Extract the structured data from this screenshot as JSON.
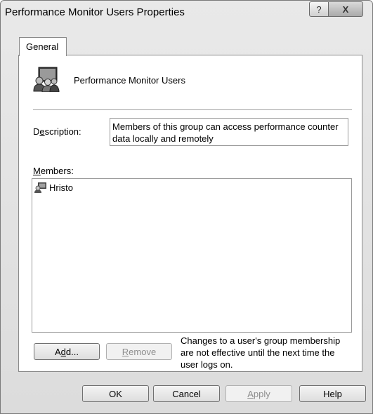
{
  "window": {
    "title": "Performance Monitor Users Properties",
    "help_glyph": "?",
    "close_glyph": "X"
  },
  "tabs": [
    {
      "label": "General"
    }
  ],
  "group": {
    "name": "Performance Monitor Users",
    "icon": "group-users-icon"
  },
  "description": {
    "label_pre": "D",
    "label_accel": "e",
    "label_post": "scription:",
    "value": "Members of this group can access performance counter data locally and remotely"
  },
  "members": {
    "label_accel": "M",
    "label_post": "embers:",
    "items": [
      {
        "name": "Hristo",
        "icon": "user-icon"
      }
    ]
  },
  "buttons": {
    "add": {
      "pre": "A",
      "accel": "d",
      "post": "d..."
    },
    "remove": {
      "accel": "R",
      "post": "emove"
    },
    "ok": "OK",
    "cancel": "Cancel",
    "apply": {
      "accel": "A",
      "post": "pply"
    },
    "help": "Help"
  },
  "note": "Changes to a user's group membership are not effective until the next time the user logs on."
}
